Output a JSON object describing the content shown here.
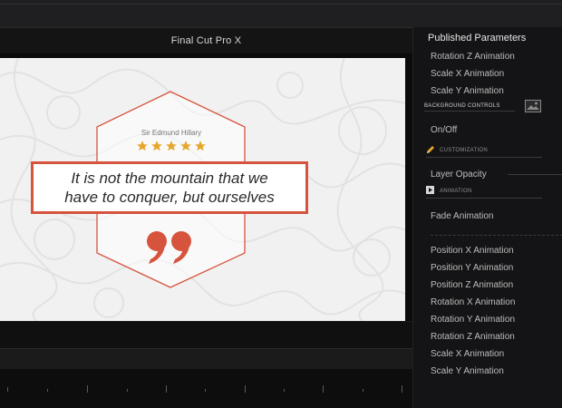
{
  "app": {
    "title": "Final Cut Pro X"
  },
  "slide": {
    "author": "Sir Edmund Hillary",
    "rating_stars": 5,
    "quote_line1": "It is not the mountain that we",
    "quote_line2": "have to conquer, but ourselves",
    "accent_color": "#d6533d",
    "star_color": "#e6a62a"
  },
  "panel": {
    "title": "Published Parameters",
    "items_top": [
      "Rotation Z Animation",
      "Scale X Animation",
      "Scale Y Animation"
    ],
    "background_controls_label": "BACKGROUND CONTROLS",
    "onoff_label": "On/Off",
    "customization_label": "CUSTOMIZATION",
    "layer_opacity_label": "Layer Opacity",
    "animation_label": "ANIMATION",
    "fade_animation_label": "Fade Animation",
    "items_bottom": [
      "Position X Animation",
      "Position Y Animation",
      "Position Z Animation",
      "Rotation X Animation",
      "Rotation Y Animation",
      "Rotation Z Animation",
      "Scale X Animation",
      "Scale Y Animation"
    ]
  }
}
